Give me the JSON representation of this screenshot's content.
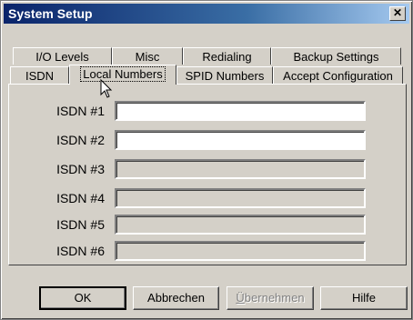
{
  "window": {
    "title": "System Setup",
    "close_glyph": "✕"
  },
  "tabs_back_row": [
    {
      "label": "I/O Levels"
    },
    {
      "label": "Misc"
    },
    {
      "label": "Redialing"
    },
    {
      "label": "Backup Settings"
    }
  ],
  "tabs_front_row": [
    {
      "label": "ISDN"
    },
    {
      "label": "Local Numbers",
      "active": true
    },
    {
      "label": "SPID Numbers"
    },
    {
      "label": "Accept Configuration"
    }
  ],
  "fields": [
    {
      "label": "ISDN #1",
      "value": "",
      "enabled": true
    },
    {
      "label": "ISDN #2",
      "value": "",
      "enabled": true
    },
    {
      "label": "ISDN #3",
      "value": "",
      "enabled": false
    },
    {
      "label": "ISDN #4",
      "value": "",
      "enabled": false
    },
    {
      "label": "ISDN #5",
      "value": "",
      "enabled": false
    },
    {
      "label": "ISDN #6",
      "value": "",
      "enabled": false
    }
  ],
  "buttons": {
    "ok": "OK",
    "cancel": "Abbrechen",
    "apply_accel": "Ü",
    "apply_rest": "bernehmen",
    "help": "Hilfe"
  },
  "icons": {
    "cursor": "arrow-cursor-icon"
  }
}
